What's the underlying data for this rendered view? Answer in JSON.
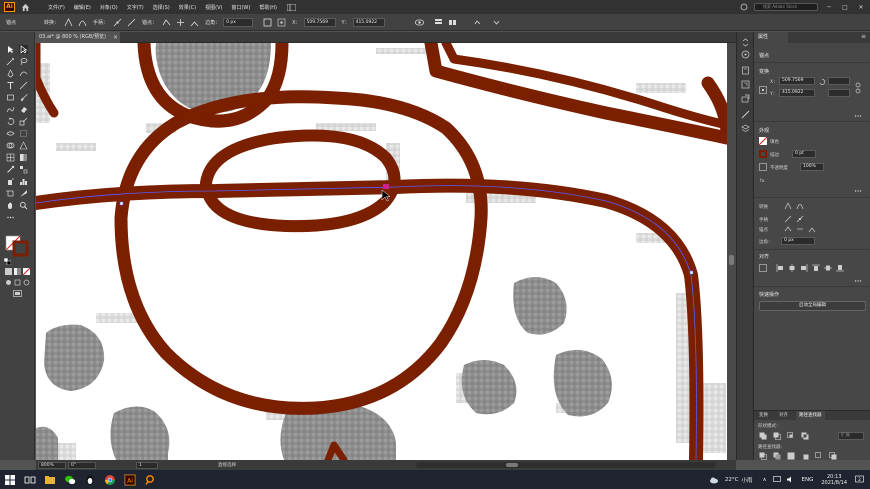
{
  "menubar": {
    "logo_text": "Ai",
    "items": [
      "文件(F)",
      "编辑(E)",
      "对象(O)",
      "文字(T)",
      "选择(S)",
      "效果(C)",
      "视图(V)",
      "窗口(W)",
      "帮助(H)"
    ],
    "search_placeholder": "搜索 Adobe Stock"
  },
  "controlbar": {
    "anchor_label": "锚点",
    "convert_label": "转换：",
    "handle_label": "手柄：",
    "anchor2_label": "锚点：",
    "corner_label": "边角：",
    "corner_value": "0 px",
    "x_label": "X：",
    "x_value": "509.7569",
    "y_label": "Y：",
    "y_value": "415.0922"
  },
  "document": {
    "tab_label": "03.ai* @ 800 % (RGB/预览)",
    "close_glyph": "×"
  },
  "statusbar": {
    "zoom": "800%",
    "rotation": "0°",
    "page": "1",
    "tool_name": "直接选择"
  },
  "panel": {
    "tab_label": "属性",
    "section_anchor": "锚点",
    "section_transform": "变换",
    "x_label": "X：",
    "x_value": "509.7569",
    "y_label": "Y：",
    "y_value": "415.0922",
    "section_appearance": "外观",
    "fill_label": "填色",
    "stroke_label": "描边",
    "stroke_value": "0 pt",
    "opacity_label": "不透明度",
    "opacity_value": "100%",
    "fx_label": "fx.",
    "section_convert": "转换",
    "section_handle": "手柄",
    "section_anchor2": "锚点",
    "corner_label": "边角：",
    "corner_value": "0 px",
    "section_align": "对齐",
    "section_quick": "快速操作",
    "quick_button": "启动全局编辑"
  },
  "pathfinder": {
    "tabs": [
      "变换",
      "对齐",
      "路径查找器"
    ],
    "shape_modes_label": "形状模式：",
    "expand_label": "扩展",
    "pathfinders_label": "路径查找器："
  },
  "taskbar": {
    "weather_temp": "22°C",
    "weather_text": "小雨",
    "lang": "ENG",
    "time": "20:13",
    "date": "2021/8/14"
  },
  "colors": {
    "stroke_brown": "#7a1f00",
    "gray_fill": "#909090",
    "path_blue": "#5a5aff",
    "anchor_magenta": "#d0208f"
  }
}
